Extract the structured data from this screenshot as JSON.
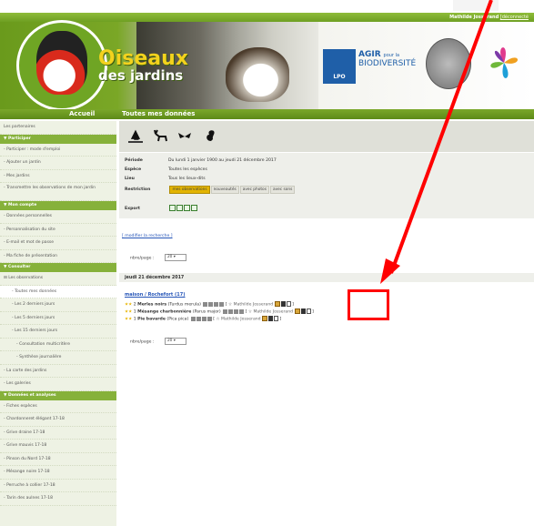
{
  "topbar": {
    "user": "Mathilde Josserand",
    "logout": "[déconnecté"
  },
  "brand": {
    "line1": "Oiseaux",
    "line2": "des jardins"
  },
  "partner": {
    "lpo": "LPO",
    "agir": "AGIR",
    "pour_la": "pour la",
    "bio": "BIODIVERSITÉ"
  },
  "nav": {
    "home": "Accueil",
    "all": "Toutes mes données"
  },
  "sidebar": {
    "partners": "Les partenaires",
    "participer": "Participer",
    "participer_items": [
      "Participer : mode d'emploi",
      "Ajouter un jardin",
      "Mes jardins",
      "Transmettre les observations de mon jardin"
    ],
    "compte": "Mon compte",
    "compte_items": [
      "Données personnelles",
      "Personnalisation du site",
      "E-mail et mot de passe",
      "Ma fiche de présentation"
    ],
    "consulter": "Consulter",
    "consulter_group": "Les observations",
    "consulter_subitems": [
      "Toutes mes données",
      "Les 2 derniers jours",
      "Les 5 derniers jours",
      "Les 15 derniers jours",
      "Consultation multicritère",
      "Synthèse journalière"
    ],
    "consulter_items": [
      "La carte des jardins",
      "Les galeries"
    ],
    "analyses": "Données et analyses",
    "analyses_items": [
      "Fiches espèces",
      "Chardonneret élégant 17-18",
      "Grive draine 17-18",
      "Grive mauvis 17-18",
      "Pinson du Nord 17-18",
      "Mésange noire 17-18",
      "Perruche à collier 17-18",
      "Tarin des aulnes 17-18"
    ]
  },
  "criteria": {
    "periode_label": "Période",
    "periode": "Du lundi 1 janvier 1900 au jeudi 21 décembre 2017",
    "espece_label": "Espèce",
    "espece": "Toutes les espèces",
    "lieu_label": "Lieu",
    "lieu": "Tous les lieux-dits",
    "restriction_label": "Restriction",
    "restrictions": [
      "mes observations",
      "nouveautés",
      "avec photos",
      "avec sons"
    ],
    "export_label": "Export"
  },
  "modify_link": "[ modifier la recherche ]",
  "perpage": {
    "label": "nbre/page :",
    "value": "20"
  },
  "day": "jeudi 21 décembre 2017",
  "place": "maison / Rochefort (17)",
  "observations": [
    {
      "count": "2",
      "name": "Merles noirs",
      "latin": "(Turdus merula)",
      "user": "Mathilde Josserand"
    },
    {
      "count": "1",
      "name": "Mésange charbonnière",
      "latin": "(Parus major)",
      "user": "Mathilde Josserand"
    },
    {
      "count": "1",
      "name": "Pie bavarde",
      "latin": "(Pica pica)",
      "user": "Mathilde Josserand"
    }
  ],
  "colors": {
    "green": "#7aa72a",
    "highlight": "#ff0000",
    "link": "#2555b8"
  }
}
